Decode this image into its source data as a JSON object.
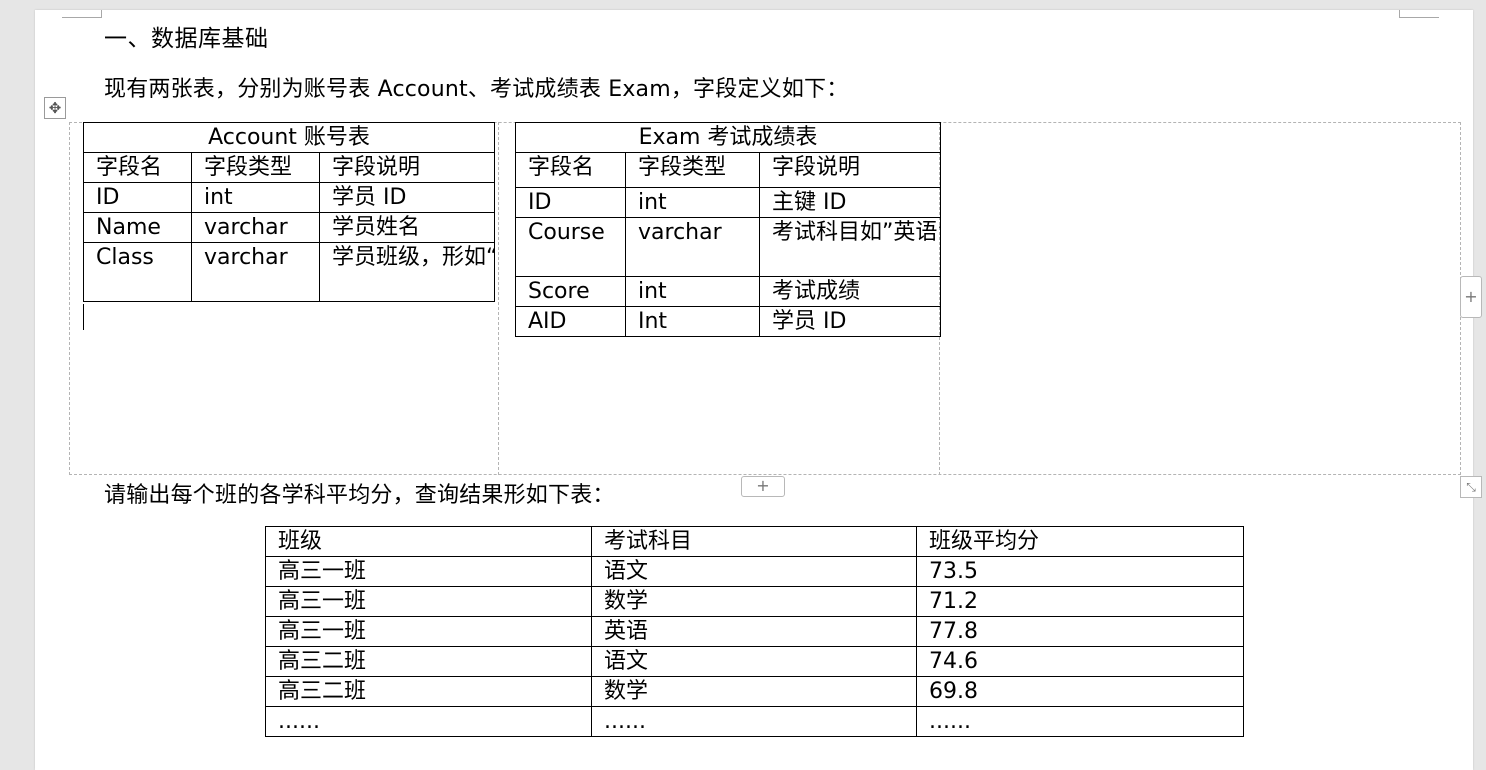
{
  "heading": "一、数据库基础",
  "intro": "现有两张表，分别为账号表 Account、考试成绩表 Exam，字段定义如下：",
  "account": {
    "title": "Account  账号表",
    "headers": [
      "字段名",
      "字段类型",
      "字段说明"
    ],
    "rows": [
      [
        "ID",
        "int",
        "学员 ID"
      ],
      [
        "Name",
        "varchar",
        "学员姓名"
      ],
      [
        "Class",
        "varchar",
        "学员班级，形如“高三一班”"
      ]
    ]
  },
  "exam": {
    "title": "Exam 考试成绩表",
    "headers": [
      "字段名",
      "字段类型",
      "字段说明"
    ],
    "rows": [
      [
        "ID",
        "int",
        "主键 ID"
      ],
      [
        "Course",
        "varchar",
        "考试科目如”英语”"
      ],
      [
        "Score",
        "int",
        "考试成绩"
      ],
      [
        "AID",
        "Int",
        "学员 ID"
      ]
    ]
  },
  "query_text": "请输出每个班的各学科平均分，查询结果形如下表：",
  "result": {
    "headers": [
      "班级",
      "考试科目",
      "班级平均分"
    ],
    "rows": [
      [
        "高三一班",
        "语文",
        "73.5"
      ],
      [
        "高三一班",
        "数学",
        "71.2"
      ],
      [
        "高三一班",
        "英语",
        "77.8"
      ],
      [
        "高三二班",
        "语文",
        "74.6"
      ],
      [
        "高三二班",
        "数学",
        "69.8"
      ],
      [
        "......",
        "......",
        "......"
      ]
    ]
  },
  "controls": {
    "move_icon": "✥",
    "add_icon": "+",
    "resize_icon": "⤡"
  }
}
